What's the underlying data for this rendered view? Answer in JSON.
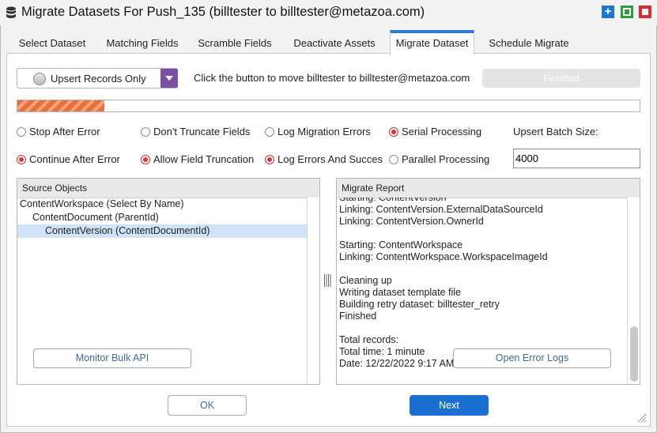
{
  "window": {
    "title": "Migrate Datasets For Push_135 (billtester to billtester@metazoa.com)",
    "buttons": [
      "+",
      "□",
      "■"
    ],
    "button_colors": [
      "#1976d2",
      "#2e9c3c",
      "#d32f2f"
    ]
  },
  "tabs": [
    {
      "label": "Select Dataset",
      "active": false
    },
    {
      "label": "Matching Fields",
      "active": false
    },
    {
      "label": "Scramble Fields",
      "active": false
    },
    {
      "label": "Deactivate Assets",
      "active": false
    },
    {
      "label": "Migrate Dataset",
      "active": true
    },
    {
      "label": "Schedule Migrate",
      "active": false
    }
  ],
  "mode_select": {
    "value": "Upsert Records Only"
  },
  "info_text": "Click the button to move billtester to billtester@metazoa.com",
  "finished_button": "Finished",
  "progress": {
    "fraction": 0.14
  },
  "options": {
    "row1": [
      {
        "label": "Stop After Error",
        "checked": false
      },
      {
        "label": "Don't Truncate Fields",
        "checked": false
      },
      {
        "label": "Log Migration Errors",
        "checked": false
      },
      {
        "label": "Serial Processing",
        "checked": true
      }
    ],
    "row2": [
      {
        "label": "Continue After Error",
        "checked": true
      },
      {
        "label": "Allow Field Truncation",
        "checked": true
      },
      {
        "label": "Log Errors And Succes",
        "checked": true
      },
      {
        "label": "Parallel Processing",
        "checked": false
      }
    ]
  },
  "batch": {
    "label": "Upsert Batch Size:",
    "value": "4000"
  },
  "source_objects": {
    "title": "Source Objects",
    "items": [
      {
        "label": "ContentWorkspace (Select By Name)",
        "level": 0,
        "selected": false
      },
      {
        "label": "ContentDocument (ParentId)",
        "level": 1,
        "selected": false
      },
      {
        "label": "ContentVersion (ContentDocumentId)",
        "level": 2,
        "selected": true
      }
    ],
    "monitor_button": "Monitor Bulk API"
  },
  "migrate_report": {
    "title": "Migrate Report",
    "lines": [
      "Starting: ContentVersion",
      "Linking: ContentVersion.ExternalDataSourceId",
      "Linking: ContentVersion.OwnerId",
      "",
      "Starting: ContentWorkspace",
      "Linking: ContentWorkspace.WorkspaceImageId",
      "",
      "Cleaning up",
      "Writing dataset template file",
      "Building retry dataset: billtester_retry",
      "Finished",
      "",
      "Total records:",
      "Total time: 1 minute",
      "Date: 12/22/2022 9:17 AM"
    ],
    "error_logs_button": "Open Error Logs"
  },
  "footer": {
    "ok": "OK",
    "next": "Next"
  },
  "colors": {
    "accent": "#2f7bd0",
    "select_arrow": "#7d4ea6",
    "next_button": "#1a6fd1",
    "progress": "#e8703a"
  }
}
